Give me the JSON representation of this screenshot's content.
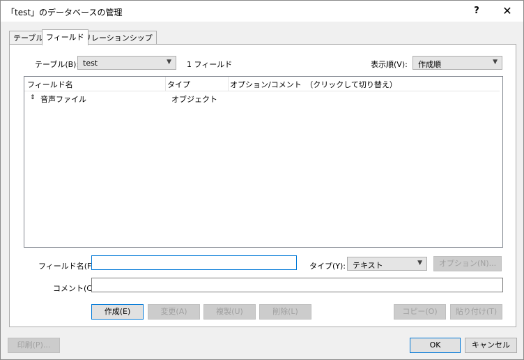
{
  "dialog": {
    "title": "「test」のデータベースの管理",
    "help_label": "?",
    "close_label": "✕"
  },
  "tabs": [
    {
      "label": "テーブル",
      "active": false
    },
    {
      "label": "フィールド",
      "active": true
    },
    {
      "label": "リレーションシップ",
      "active": false
    }
  ],
  "table_selector": {
    "label": "テーブル(B):",
    "value": "test",
    "field_count": "1 フィールド"
  },
  "sort_selector": {
    "label": "表示順(V):",
    "value": "作成順"
  },
  "list": {
    "columns": [
      "フィールド名",
      "タイプ",
      "オプション/コメント　（クリックして切り替え）"
    ],
    "rows": [
      {
        "handle": "⇕",
        "name": "音声ファイル",
        "type": "オブジェクト",
        "options": ""
      }
    ]
  },
  "field_form": {
    "name_label": "フィールド名(F):",
    "name_value": "",
    "type_label": "タイプ(Y):",
    "type_value": "テキスト",
    "options_button": "オプション(N)...",
    "comment_label": "コメント(C):",
    "comment_value": ""
  },
  "actions": {
    "create": "作成(E)",
    "change": "変更(A)",
    "duplicate": "複製(U)",
    "delete": "削除(L)",
    "copy": "コピー(O)",
    "paste": "貼り付け(T)"
  },
  "footer": {
    "print": "印刷(P)...",
    "ok": "OK",
    "cancel": "キャンセル"
  }
}
